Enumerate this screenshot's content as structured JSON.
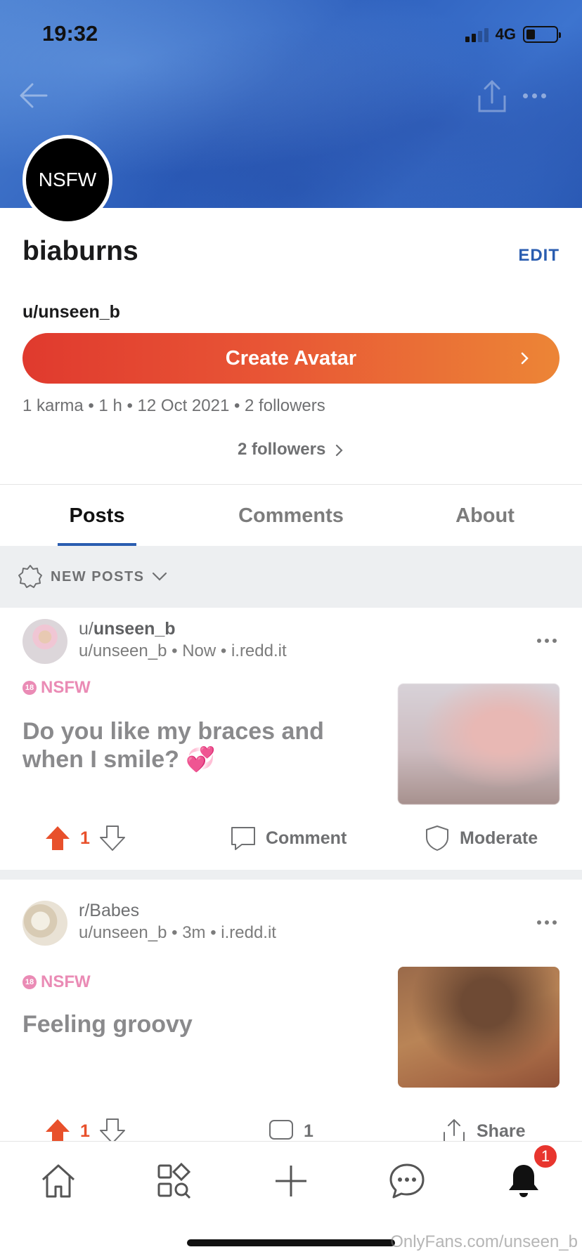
{
  "status_bar": {
    "time": "19:32",
    "network": "4G",
    "battery_level": 0.3
  },
  "profile": {
    "avatar_text": "NSFW",
    "display_name": "biaburns",
    "edit_label": "EDIT",
    "handle": "u/unseen_b",
    "create_avatar_label": "Create Avatar",
    "meta": "1 karma • 1 h • 12 Oct 2021 • 2 followers",
    "followers_link": "2 followers"
  },
  "tabs": [
    {
      "label": "Posts",
      "active": true
    },
    {
      "label": "Comments",
      "active": false
    },
    {
      "label": "About",
      "active": false
    }
  ],
  "sort": {
    "label": "NEW POSTS"
  },
  "posts": [
    {
      "subreddit_prefix": "u/",
      "subreddit_name": "unseen_b",
      "info": "u/unseen_b • Now • i.redd.it",
      "nsfw_label": "NSFW",
      "title": "Do you like my braces and when I smile? 💞",
      "votes": "1",
      "comment_label": "Comment",
      "moderate_label": "Moderate"
    },
    {
      "subreddit_prefix": "r/",
      "subreddit_name": "Babes",
      "info": "u/unseen_b • 3m • i.redd.it",
      "nsfw_label": "NSFW",
      "title": "Feeling groovy",
      "votes": "1",
      "comments": "1",
      "share_label": "Share"
    }
  ],
  "bottom_nav": {
    "items": [
      "home-icon",
      "discover-icon",
      "create-icon",
      "chat-icon",
      "notifications-icon"
    ],
    "notification_badge": "1"
  },
  "watermark": "OnlyFans.com/unseen_b",
  "colors": {
    "accent": "#2a5db0",
    "upvote": "#e8502b",
    "nsfw": "#ea8bb5",
    "badge": "#e8352e"
  }
}
